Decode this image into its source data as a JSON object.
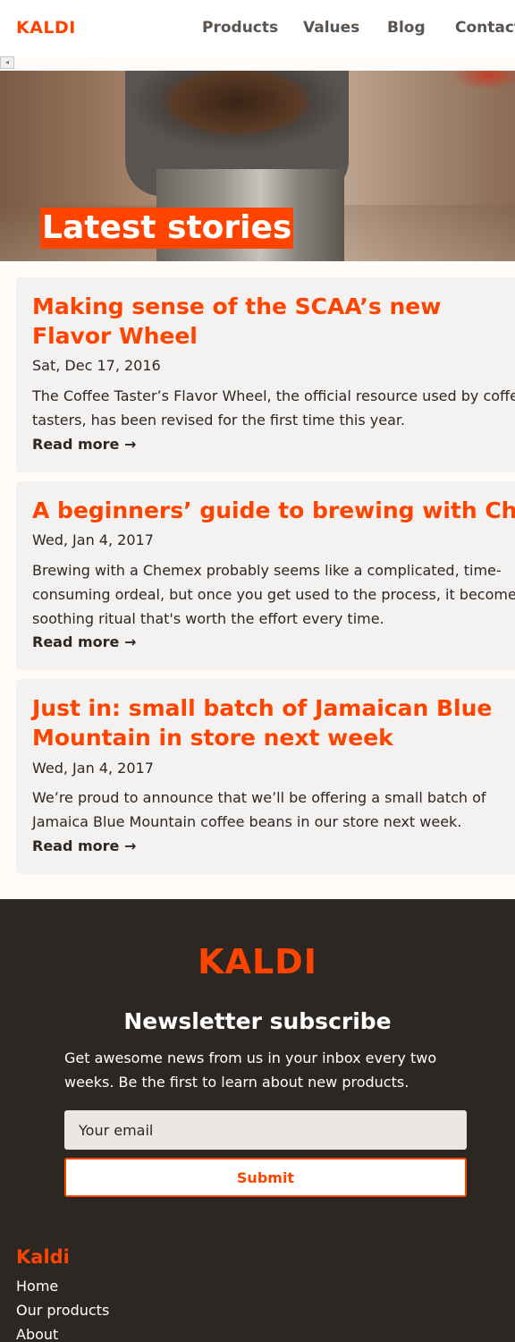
{
  "header": {
    "logo": "KALDI",
    "nav": [
      "Products",
      "Values",
      "Blog",
      "Contact"
    ]
  },
  "hero": {
    "title": "Latest stories"
  },
  "stories": [
    {
      "title": "Making sense of the SCAA’s new Flavor Wheel",
      "date": "Sat, Dec 17, 2016",
      "excerpt": "The Coffee Taster’s Flavor Wheel, the official resource used by coffee tasters, has been revised for the first time this year.",
      "more": "Read more →"
    },
    {
      "title": "A beginners’ guide to brewing with Chemex",
      "date": "Wed, Jan 4, 2017",
      "excerpt": "Brewing with a Chemex probably seems like a complicated, time-consuming ordeal, but once you get used to the process, it becomes a soothing ritual that's worth the effort every time.",
      "more": "Read more →"
    },
    {
      "title": "Just in: small batch of Jamaican Blue Mountain in store next week",
      "date": "Wed, Jan 4, 2017",
      "excerpt": "We’re proud to announce that we’ll be offering a small batch of Jamaica Blue Mountain coffee beans in our store next week.",
      "more": "Read more →"
    }
  ],
  "footer": {
    "logo": "KALDI",
    "newsletter_title": "Newsletter subscribe",
    "newsletter_desc": "Get awesome news from us in your inbox every two weeks. Be the first to learn about new products.",
    "email_placeholder": "Your email",
    "submit_label": "Submit",
    "column_title": "Kaldi",
    "links": [
      "Home",
      "Our products",
      "About"
    ]
  },
  "colors": {
    "accent": "#ff4400",
    "dark": "#2d2724",
    "card_bg": "#f4f2f1"
  }
}
